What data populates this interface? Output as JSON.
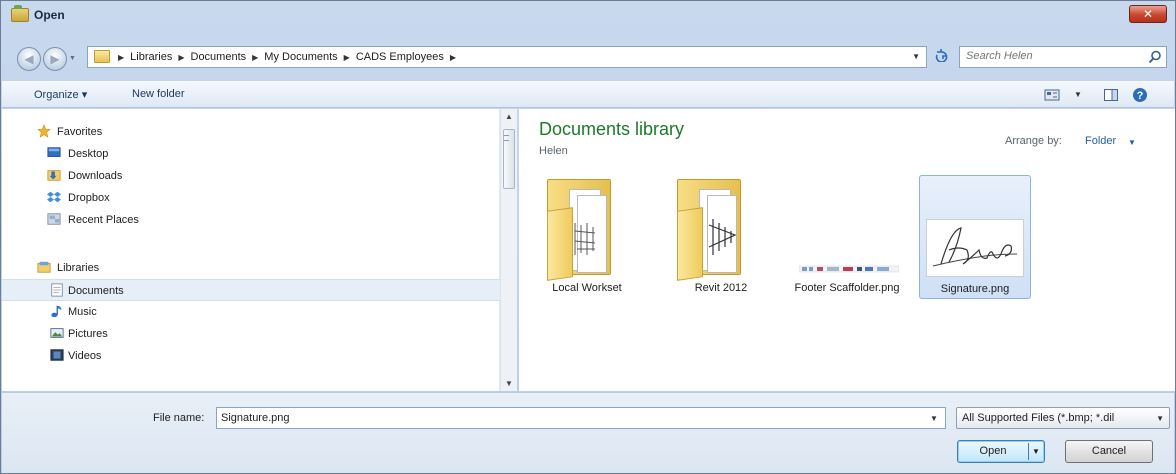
{
  "window": {
    "title": "Open",
    "close_symbol": "✕"
  },
  "address_bar": {
    "breadcrumbs": [
      "Libraries",
      "Documents",
      "My Documents",
      "CADS Employees"
    ],
    "search_placeholder": "Search Helen"
  },
  "toolbar": {
    "organize": "Organize ▾",
    "new_folder": "New folder"
  },
  "navigation": {
    "favorites_header": "Favorites",
    "favorites": [
      "Desktop",
      "Downloads",
      "Dropbox",
      "Recent Places"
    ],
    "libraries_header": "Libraries",
    "libraries": [
      "Documents",
      "Music",
      "Pictures",
      "Videos"
    ],
    "selected": "Documents"
  },
  "content": {
    "library_title": "Documents library",
    "library_subtitle": "Helen",
    "arrange_by_label": "Arrange by:",
    "arrange_by_value": "Folder",
    "items": [
      {
        "name": "Local Workset",
        "type": "folder"
      },
      {
        "name": "Revit 2012",
        "type": "folder"
      },
      {
        "name": "Footer Scaffolder.png",
        "type": "image"
      },
      {
        "name": "Signature.png",
        "type": "image",
        "selected": true
      }
    ]
  },
  "footer": {
    "file_name_label": "File name:",
    "file_name_value": "Signature.png",
    "file_type_filter": "All Supported Files (*.bmp; *.dil",
    "open_label": "Open",
    "cancel_label": "Cancel"
  },
  "colors": {
    "library_title": "#1c7a2a",
    "link": "#1f5fa8",
    "selection": "#cfe0f6"
  }
}
